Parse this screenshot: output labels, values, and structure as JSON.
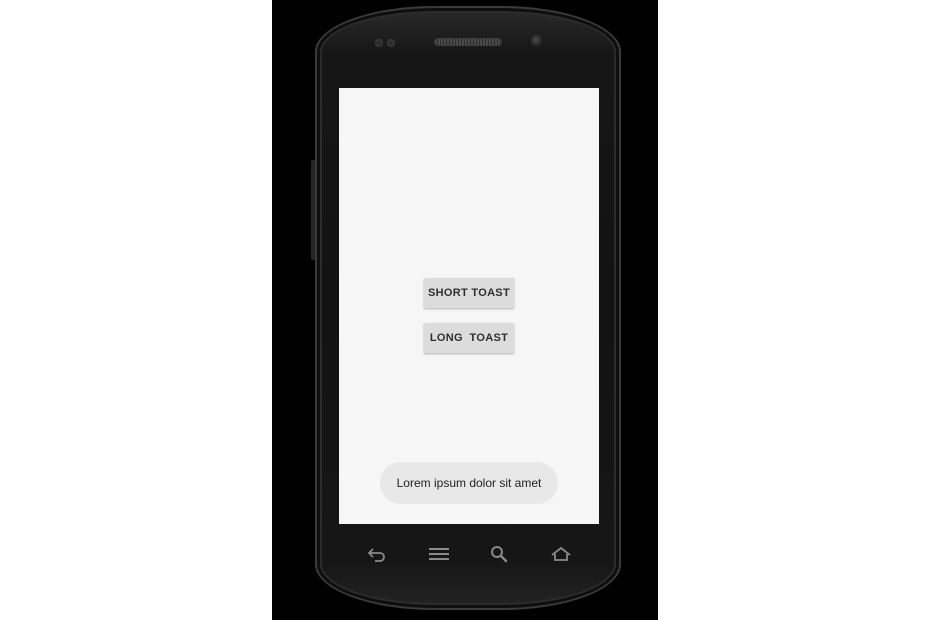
{
  "buttons": {
    "short_toast": "SHORT TOAST",
    "long_toast": "LONG  TOAST"
  },
  "toast": {
    "message": "Lorem ipsum dolor sit amet"
  },
  "nav_bar": {
    "items": [
      {
        "icon": "back-icon"
      },
      {
        "icon": "menu-icon"
      },
      {
        "icon": "search-icon"
      },
      {
        "icon": "home-icon"
      }
    ]
  },
  "colors": {
    "screen_background": "#f6f6f6",
    "button_background": "#dcdcdc",
    "toast_background": "#e8e8e8",
    "device_body": "#161616"
  }
}
